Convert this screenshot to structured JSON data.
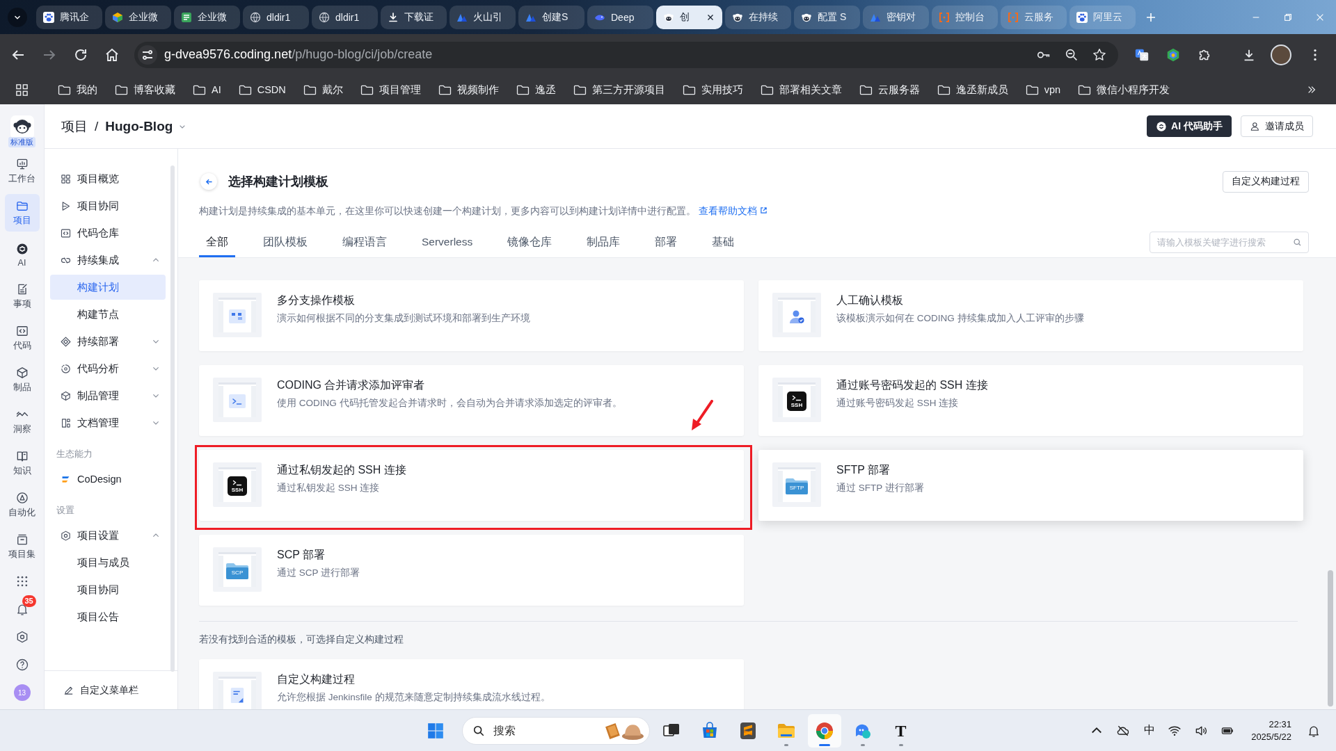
{
  "browser": {
    "tabs": [
      {
        "title": "腾讯企",
        "kind": "paw",
        "selected": false
      },
      {
        "title": "企业微",
        "kind": "cube",
        "selected": false
      },
      {
        "title": "企业微",
        "kind": "calendar",
        "selected": false
      },
      {
        "title": "dldir1",
        "kind": "globe",
        "selected": false
      },
      {
        "title": "dldir1",
        "kind": "globe",
        "selected": false
      },
      {
        "title": "下载证",
        "kind": "download",
        "selected": false
      },
      {
        "title": "火山引",
        "kind": "volcano",
        "selected": false
      },
      {
        "title": "创建S",
        "kind": "volcano",
        "selected": false
      },
      {
        "title": "Deep",
        "kind": "whale",
        "selected": false
      },
      {
        "title": "创",
        "kind": "coding",
        "selected": true
      },
      {
        "title": "在持续",
        "kind": "coding",
        "selected": false
      },
      {
        "title": "配置 S",
        "kind": "coding",
        "selected": false
      },
      {
        "title": "密钥对",
        "kind": "volcano",
        "selected": false
      },
      {
        "title": "控制台",
        "kind": "bracket",
        "selected": false
      },
      {
        "title": "云服务",
        "kind": "bracket",
        "selected": false
      },
      {
        "title": "阿里云",
        "kind": "paw",
        "selected": false
      }
    ],
    "forward_disabled": true,
    "url": {
      "host": "g-dvea9576.coding.net",
      "path": "/p/hugo-blog/ci/job/create"
    },
    "bookmarks": [
      "我的",
      "博客收藏",
      "AI",
      "CSDN",
      "戴尔",
      "项目管理",
      "视频制作",
      "逸丞",
      "第三方开源项目",
      "实用技巧",
      "部署相关文章",
      "云服务器",
      "逸丞新成员",
      "vpn",
      "微信小程序开发"
    ]
  },
  "app": {
    "rail": {
      "edition": "标准版",
      "items": [
        {
          "label": "工作台",
          "kind": "workbench",
          "selected": false
        },
        {
          "label": "项目",
          "kind": "project",
          "selected": true
        },
        {
          "label": "AI",
          "kind": "ai",
          "selected": false
        },
        {
          "label": "事项",
          "kind": "issue",
          "selected": false
        },
        {
          "label": "代码",
          "kind": "code",
          "selected": false
        },
        {
          "label": "制品",
          "kind": "artifact",
          "selected": false
        },
        {
          "label": "洞察",
          "kind": "insight",
          "selected": false
        },
        {
          "label": "知识",
          "kind": "knowledge",
          "selected": false
        },
        {
          "label": "自动化",
          "kind": "automation",
          "selected": false
        },
        {
          "label": "项目集",
          "kind": "program",
          "selected": false
        }
      ],
      "notification_count": "35",
      "avatar_text": "13"
    },
    "header": {
      "breadcrumb": [
        "项目",
        "Hugo-Blog"
      ],
      "separator": "/",
      "buttons": [
        {
          "label": "AI 代码助手",
          "kind": "primary"
        },
        {
          "label": "邀请成员",
          "kind": "default"
        }
      ]
    },
    "sidebar": {
      "items": [
        {
          "label": "项目概览",
          "kind": "overview",
          "selected": false
        },
        {
          "label": "项目协同",
          "kind": "collab",
          "selected": false
        },
        {
          "label": "代码仓库",
          "kind": "repo",
          "selected": false
        },
        {
          "label": "持续集成",
          "kind": "ci",
          "selected": false,
          "expanded": true,
          "children": [
            {
              "label": "构建计划",
              "selected": true
            },
            {
              "label": "构建节点",
              "selected": false
            }
          ]
        },
        {
          "label": "持续部署",
          "kind": "cd",
          "selected": false,
          "expanded": false
        },
        {
          "label": "代码分析",
          "kind": "analysis",
          "selected": false,
          "expanded": false
        },
        {
          "label": "制品管理",
          "kind": "artifact",
          "selected": false,
          "expanded": false
        },
        {
          "label": "文档管理",
          "kind": "docs",
          "selected": false,
          "expanded": false
        }
      ],
      "sections": [
        {
          "heading": "生态能力",
          "items": [
            {
              "label": "CoDesign",
              "kind": "codesign",
              "selected": false
            }
          ]
        },
        {
          "heading": "设置",
          "items": [
            {
              "label": "项目设置",
              "kind": "settings",
              "selected": false,
              "expanded": true,
              "children": [
                {
                  "label": "项目与成员",
                  "selected": false
                },
                {
                  "label": "项目协同",
                  "selected": false
                },
                {
                  "label": "项目公告",
                  "selected": false
                }
              ]
            }
          ]
        }
      ],
      "footer": "自定义菜单栏"
    },
    "page": {
      "title": "选择构建计划模板",
      "action": "自定义构建过程",
      "description": "构建计划是持续集成的基本单元，在这里你可以快速创建一个构建计划，更多内容可以到构建计划详情中进行配置。",
      "help_link": "查看帮助文档",
      "tabs": [
        {
          "label": "全部",
          "selected": true
        },
        {
          "label": "团队模板",
          "selected": false
        },
        {
          "label": "编程语言",
          "selected": false
        },
        {
          "label": "Serverless",
          "selected": false
        },
        {
          "label": "镜像仓库",
          "selected": false
        },
        {
          "label": "制品库",
          "selected": false
        },
        {
          "label": "部署",
          "selected": false
        },
        {
          "label": "基础",
          "selected": false
        }
      ],
      "search": {
        "placeholder": "请输入模板关键字进行搜索"
      },
      "templates": [
        {
          "title": "多分支操作模板",
          "description": "演示如何根据不同的分支集成到测试环境和部署到生产环境",
          "thumb": {
            "kind": "branch"
          },
          "highlighted": false,
          "hovered": false
        },
        {
          "title": "人工确认模板",
          "description": "该模板演示如何在 CODING 持续集成加入人工评审的步骤",
          "thumb": {
            "kind": "person"
          },
          "highlighted": false,
          "hovered": false
        },
        {
          "title": "CODING 合并请求添加评审者",
          "description": "使用 CODING 代码托管发起合并请求时，会自动为合并请求添加选定的评审者。",
          "thumb": {
            "kind": "terminal"
          },
          "highlighted": false,
          "hovered": false
        },
        {
          "title": "通过账号密码发起的 SSH 连接",
          "description": "通过账号密码发起 SSH 连接",
          "thumb": {
            "kind": "ssh",
            "label": "SSH"
          },
          "highlighted": false,
          "hovered": false
        },
        {
          "title": "通过私钥发起的 SSH 连接",
          "description": "通过私钥发起 SSH 连接",
          "thumb": {
            "kind": "ssh",
            "label": "SSH"
          },
          "highlighted": true,
          "hovered": false
        },
        {
          "title": "SFTP 部署",
          "description": "通过 SFTP 进行部署",
          "thumb": {
            "kind": "folder",
            "label": "SFTP"
          },
          "highlighted": false,
          "hovered": true
        },
        {
          "title": "SCP 部署",
          "description": "通过 SCP 进行部署",
          "thumb": {
            "kind": "folder",
            "label": "SCP"
          },
          "highlighted": false,
          "hovered": false
        }
      ],
      "fallback_note": "若没有找到合适的模板，可选择自定义构建过程",
      "custom_templates": [
        {
          "title": "自定义构建过程",
          "description": "允许您根据 Jenkinsfile 的规范来随意定制持续集成流水线过程。",
          "thumb": {
            "kind": "file"
          },
          "highlighted": false,
          "hovered": false
        }
      ]
    }
  },
  "taskbar": {
    "search": {
      "placeholder": "搜索"
    },
    "apps": [
      {
        "kind": "taskview",
        "running": false,
        "selected": false
      },
      {
        "kind": "store",
        "running": false,
        "selected": false
      },
      {
        "kind": "sublime",
        "running": false,
        "selected": false
      },
      {
        "kind": "explorer",
        "running": true,
        "selected": false
      },
      {
        "kind": "chrome",
        "running": true,
        "selected": true
      },
      {
        "kind": "chat",
        "running": true,
        "selected": false
      },
      {
        "kind": "typora",
        "label": "T",
        "running": true,
        "selected": false
      }
    ],
    "ime": "中",
    "time": "22:31",
    "date": "2025/5/22"
  }
}
